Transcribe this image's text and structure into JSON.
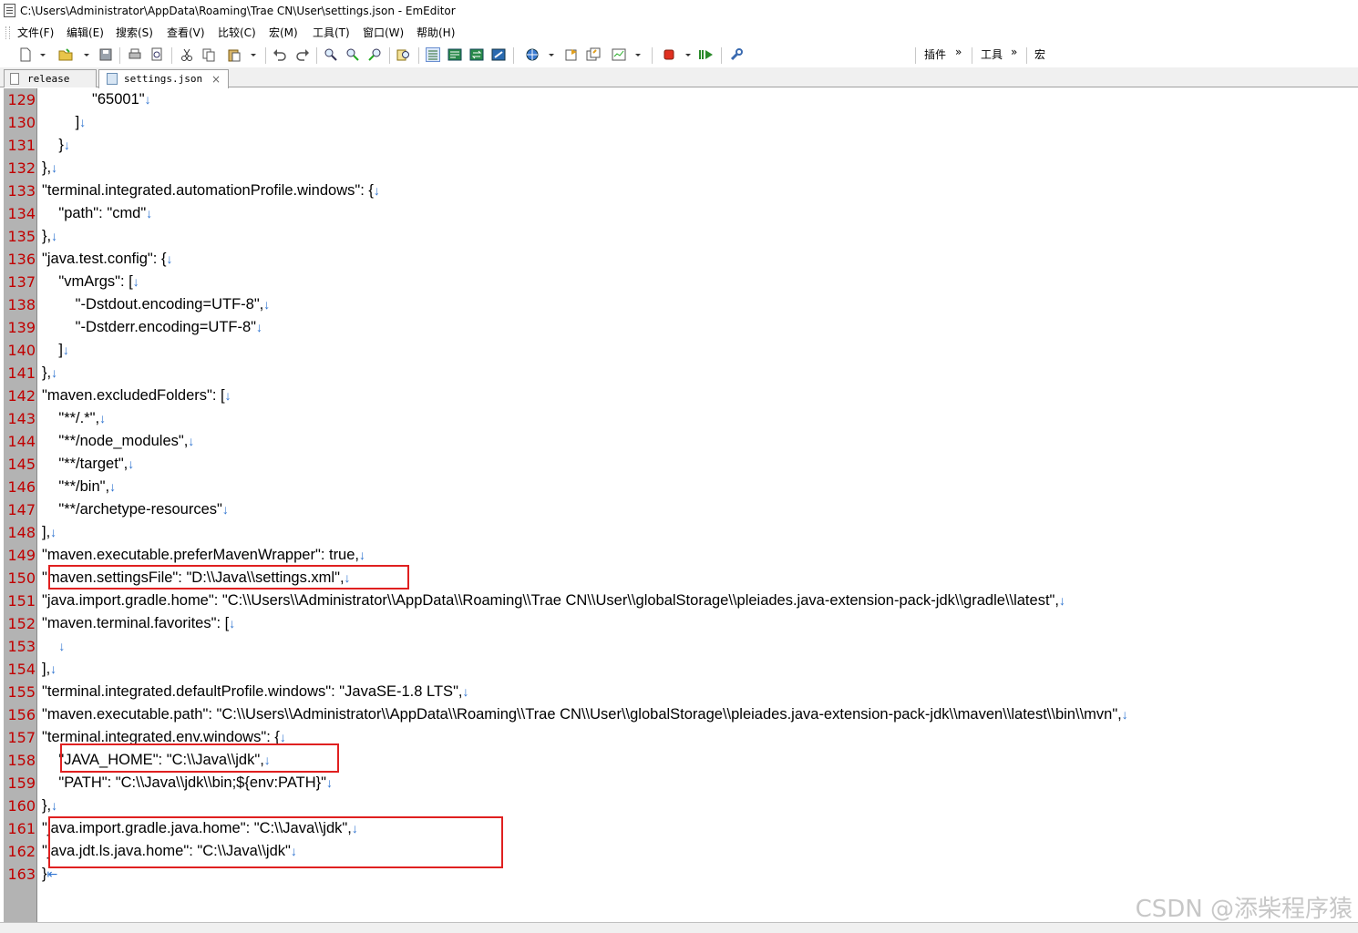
{
  "window": {
    "title": "C:\\Users\\Administrator\\AppData\\Roaming\\Trae CN\\User\\settings.json - EmEditor"
  },
  "menu": [
    "文件(F)",
    "编辑(E)",
    "搜索(S)",
    "查看(V)",
    "比较(C)",
    "宏(M)",
    "工具(T)",
    "窗口(W)",
    "帮助(H)"
  ],
  "toolbar": {
    "plugins_label": "插件",
    "tools_label": "工具",
    "macros_label": "宏",
    "more": "»"
  },
  "tabs": [
    {
      "label": "release",
      "active": false
    },
    {
      "label": "settings.json",
      "active": true
    }
  ],
  "tab_close": "×",
  "newline_marker": "↓",
  "eof_marker": "⇤",
  "lines": [
    {
      "num": "129",
      "text": "            \"65001\""
    },
    {
      "num": "130",
      "text": "        ]"
    },
    {
      "num": "131",
      "text": "    }"
    },
    {
      "num": "132",
      "text": "},"
    },
    {
      "num": "133",
      "text": "\"terminal.integrated.automationProfile.windows\": {"
    },
    {
      "num": "134",
      "text": "    \"path\": \"cmd\""
    },
    {
      "num": "135",
      "text": "},"
    },
    {
      "num": "136",
      "text": "\"java.test.config\": {"
    },
    {
      "num": "137",
      "text": "    \"vmArgs\": ["
    },
    {
      "num": "138",
      "text": "        \"-Dstdout.encoding=UTF-8\","
    },
    {
      "num": "139",
      "text": "        \"-Dstderr.encoding=UTF-8\""
    },
    {
      "num": "140",
      "text": "    ]"
    },
    {
      "num": "141",
      "text": "},"
    },
    {
      "num": "142",
      "text": "\"maven.excludedFolders\": ["
    },
    {
      "num": "143",
      "text": "    \"**/.*\","
    },
    {
      "num": "144",
      "text": "    \"**/node_modules\","
    },
    {
      "num": "145",
      "text": "    \"**/target\","
    },
    {
      "num": "146",
      "text": "    \"**/bin\","
    },
    {
      "num": "147",
      "text": "    \"**/archetype-resources\""
    },
    {
      "num": "148",
      "text": "],"
    },
    {
      "num": "149",
      "text": "\"maven.executable.preferMavenWrapper\": true,"
    },
    {
      "num": "150",
      "text": "\"maven.settingsFile\": \"D:\\\\Java\\\\settings.xml\","
    },
    {
      "num": "151",
      "text": "\"java.import.gradle.home\": \"C:\\\\Users\\\\Administrator\\\\AppData\\\\Roaming\\\\Trae CN\\\\User\\\\globalStorage\\\\pleiades.java-extension-pack-jdk\\\\gradle\\\\latest\","
    },
    {
      "num": "152",
      "text": "\"maven.terminal.favorites\": ["
    },
    {
      "num": "153",
      "text": "    "
    },
    {
      "num": "154",
      "text": "],"
    },
    {
      "num": "155",
      "text": "\"terminal.integrated.defaultProfile.windows\": \"JavaSE-1.8 LTS\","
    },
    {
      "num": "156",
      "text": "\"maven.executable.path\": \"C:\\\\Users\\\\Administrator\\\\AppData\\\\Roaming\\\\Trae CN\\\\User\\\\globalStorage\\\\pleiades.java-extension-pack-jdk\\\\maven\\\\latest\\\\bin\\\\mvn\","
    },
    {
      "num": "157",
      "text": "\"terminal.integrated.env.windows\": {"
    },
    {
      "num": "158",
      "text": "    \"JAVA_HOME\": \"C:\\\\Java\\\\jdk\","
    },
    {
      "num": "159",
      "text": "    \"PATH\": \"C:\\\\Java\\\\jdk\\\\bin;${env:PATH}\""
    },
    {
      "num": "160",
      "text": "},"
    },
    {
      "num": "161",
      "text": "\"java.import.gradle.java.home\": \"C:\\\\Java\\\\jdk\","
    },
    {
      "num": "162",
      "text": "\"java.jdt.ls.java.home\": \"C:\\\\Java\\\\jdk\""
    },
    {
      "num": "163",
      "text": "}"
    }
  ],
  "watermark": "CSDN @添柴程序猿",
  "colors": {
    "line_number": "#c00000",
    "gutter": "#b3b3b3",
    "newline_marker": "#2f74d0",
    "highlight_box": "#e02020"
  }
}
